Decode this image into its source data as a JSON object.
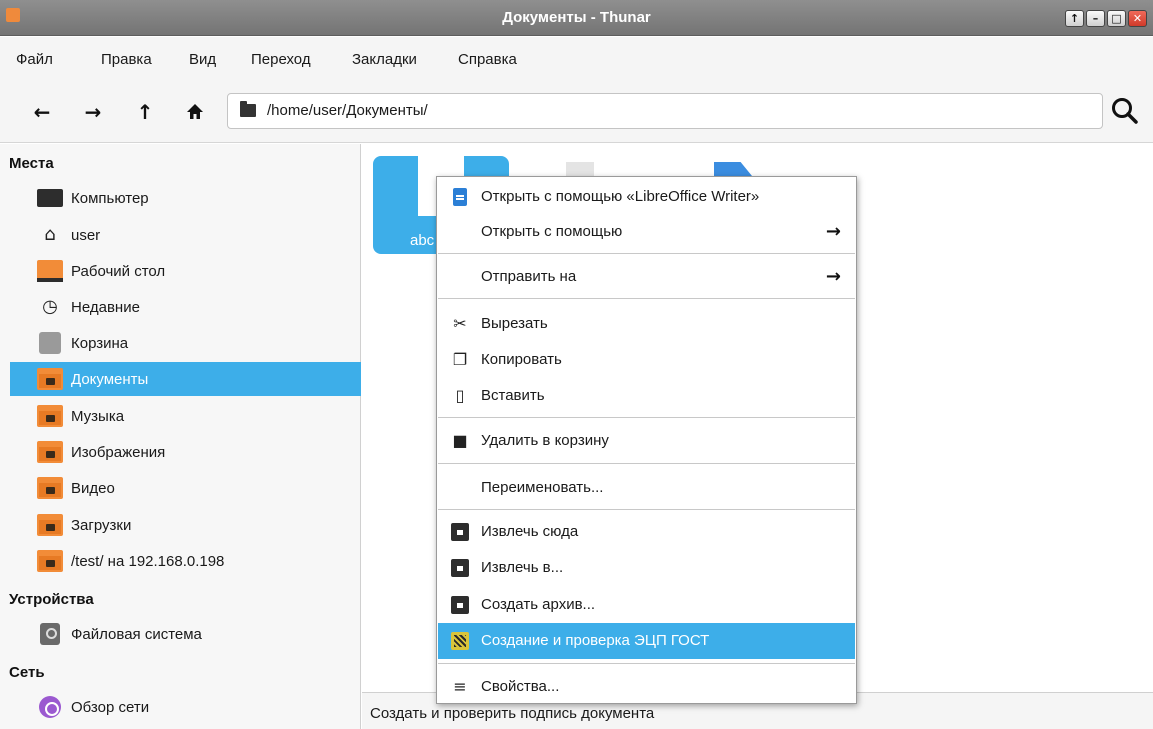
{
  "window": {
    "title": "Документы - Thunar",
    "buttons": [
      "↑",
      "–",
      "□",
      "✕"
    ]
  },
  "menubar": {
    "items": [
      "Файл",
      "Правка",
      "Вид",
      "Переход",
      "Закладки",
      "Справка"
    ]
  },
  "toolbar": {
    "back": "←",
    "forward": "→",
    "up": "↑",
    "home": "⌂",
    "location": "/home/user/Документы/",
    "search_icon": "search-icon"
  },
  "sidebar": {
    "places_header": "Места",
    "places": [
      {
        "label": "Компьютер",
        "icon": "computer-icon"
      },
      {
        "label": "user",
        "icon": "home-icon"
      },
      {
        "label": "Рабочий стол",
        "icon": "desktop-icon"
      },
      {
        "label": "Недавние",
        "icon": "clock-icon"
      },
      {
        "label": "Корзина",
        "icon": "trash-icon"
      },
      {
        "label": "Документы",
        "icon": "documents-folder-icon",
        "selected": true
      },
      {
        "label": "Музыка",
        "icon": "music-folder-icon"
      },
      {
        "label": "Изображения",
        "icon": "pictures-folder-icon"
      },
      {
        "label": "Видео",
        "icon": "video-folder-icon"
      },
      {
        "label": "Загрузки",
        "icon": "downloads-folder-icon"
      },
      {
        "label": "/test/ на 192.168.0.198",
        "icon": "network-folder-icon"
      }
    ],
    "devices_header": "Устройства",
    "devices": [
      {
        "label": "Файловая система",
        "icon": "drive-icon"
      }
    ],
    "network_header": "Сеть",
    "network": [
      {
        "label": "Обзор сети",
        "icon": "network-icon"
      }
    ]
  },
  "files": [
    {
      "name": "abc",
      "selected": true
    }
  ],
  "context_menu": {
    "groups": [
      [
        {
          "label": "Открыть с помощью «LibreOffice Writer»",
          "icon": "writer-icon"
        },
        {
          "label": "Открыть с помощью",
          "submenu": true
        }
      ],
      [
        {
          "label": "Отправить на",
          "submenu": true
        }
      ],
      [
        {
          "label": "Вырезать",
          "icon": "scissors-icon"
        },
        {
          "label": "Копировать",
          "icon": "copy-icon"
        },
        {
          "label": "Вставить",
          "icon": "paste-icon"
        }
      ],
      [
        {
          "label": "Удалить в корзину",
          "icon": "trash-icon"
        }
      ],
      [
        {
          "label": "Переименовать..."
        }
      ],
      [
        {
          "label": "Извлечь сюда",
          "icon": "archive-extract-icon"
        },
        {
          "label": "Извлечь в...",
          "icon": "archive-extract-icon"
        },
        {
          "label": "Создать архив...",
          "icon": "archive-create-icon"
        },
        {
          "label": "Создание и проверка ЭЦП ГОСТ",
          "icon": "signature-icon",
          "highlighted": true
        }
      ],
      [
        {
          "label": "Свойства...",
          "icon": "properties-icon"
        }
      ]
    ],
    "submenu_arrow": "→"
  },
  "statusbar": {
    "text": "Создать и проверить подпись документа"
  },
  "colors": {
    "selection": "#3daee9",
    "folder": "#f28c38",
    "titlebar": "#7f7f7f"
  }
}
